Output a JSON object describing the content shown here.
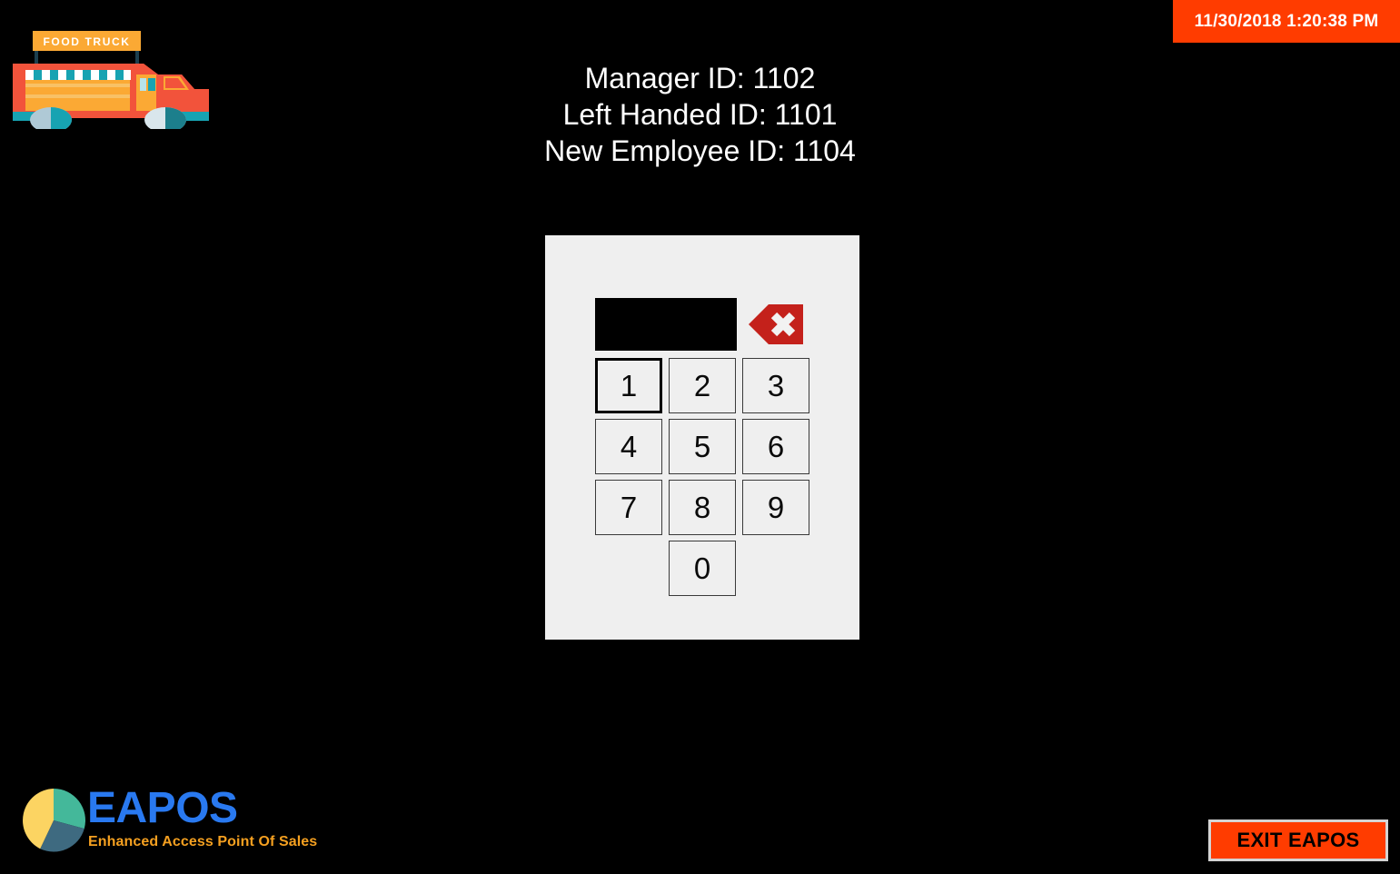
{
  "app": {
    "name": "EAPOS",
    "background_color": "#000000",
    "accent_color": "#FF3C00"
  },
  "datetime_banner": {
    "text": "11/30/2018 1:20:38 PM",
    "background_color": "#FF3C00",
    "text_color": "#FFFFFF"
  },
  "logo": {
    "truck_sign_text": "FOOD TRUCK",
    "truck_body_color": "#F2533B",
    "truck_panel_color": "#FBA934",
    "truck_accent_color": "#17A3B2",
    "icon_name": "food-truck-icon"
  },
  "header": {
    "lines": [
      "Manager ID: 1102",
      "Left Handed ID: 1101",
      "New Employee ID: 1104"
    ],
    "manager_label": "Manager ID:",
    "manager_id": "1102",
    "left_handed_label": "Left Handed ID:",
    "left_handed_id": "1101",
    "new_employee_label": "New Employee ID:",
    "new_employee_id": "1104",
    "text_color": "#FFFFFF"
  },
  "keypad": {
    "panel_color": "#EFEFEF",
    "display": {
      "value": "",
      "placeholder": "",
      "background_color": "#000000",
      "text_color": "#FFFFFF"
    },
    "backspace": {
      "icon_name": "backspace-delete-icon",
      "color": "#C4211B",
      "glyph_color": "#F2F2F2",
      "label": ""
    },
    "keys": [
      {
        "label": "1",
        "focused": true
      },
      {
        "label": "2",
        "focused": false
      },
      {
        "label": "3",
        "focused": false
      },
      {
        "label": "4",
        "focused": false
      },
      {
        "label": "5",
        "focused": false
      },
      {
        "label": "6",
        "focused": false
      },
      {
        "label": "7",
        "focused": false
      },
      {
        "label": "8",
        "focused": false
      },
      {
        "label": "9",
        "focused": false
      },
      {
        "label": "0",
        "focused": false
      }
    ]
  },
  "branding": {
    "wordmark": "EAPOS",
    "wordmark_color": "#2979F0",
    "tagline": "Enhanced Access Point Of Sales",
    "tagline_color": "#F5A020",
    "pie_icon_name": "pie-chart-icon",
    "pie_segments": [
      {
        "name": "yellow",
        "color": "#FCD462",
        "share": 0.43
      },
      {
        "name": "teal",
        "color": "#44B89A",
        "share": 0.29
      },
      {
        "name": "slate",
        "color": "#3E6A80",
        "share": 0.28
      }
    ]
  },
  "footer": {
    "exit_label": "EXIT EAPOS",
    "exit_background_color": "#FF3C00",
    "exit_text_color": "#000000",
    "exit_border_color": "#D4D4D4"
  }
}
